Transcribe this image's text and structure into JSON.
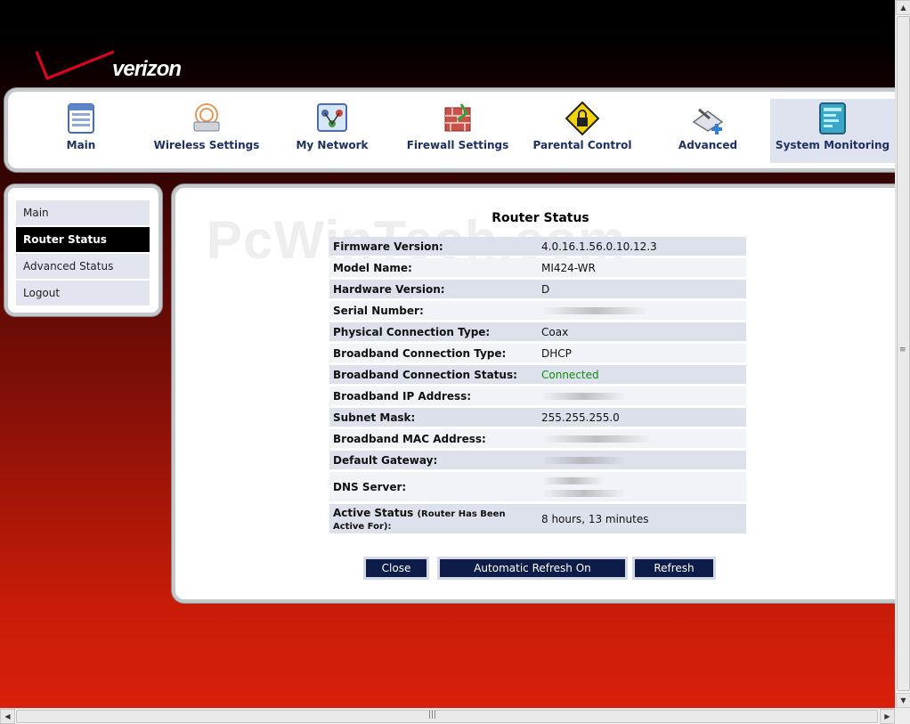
{
  "logo": {
    "text": "verizon"
  },
  "nav": {
    "items": [
      {
        "label": "Main",
        "icon": "main-table-icon"
      },
      {
        "label": "Wireless Settings",
        "icon": "wireless-router-icon"
      },
      {
        "label": "My Network",
        "icon": "network-icon"
      },
      {
        "label": "Firewall Settings",
        "icon": "firewall-icon"
      },
      {
        "label": "Parental Control",
        "icon": "lock-sign-icon"
      },
      {
        "label": "Advanced",
        "icon": "advanced-tools-icon"
      },
      {
        "label": "System Monitoring",
        "icon": "monitor-icon",
        "active": true
      }
    ]
  },
  "sidebar": {
    "items": [
      {
        "label": "Main"
      },
      {
        "label": "Router Status",
        "active": true
      },
      {
        "label": "Advanced Status"
      },
      {
        "label": "Logout"
      }
    ]
  },
  "watermark": "PcWinTech.com",
  "page_title": "Router Status",
  "status_rows": [
    {
      "label": "Firmware Version:",
      "value": "4.0.16.1.56.0.10.12.3"
    },
    {
      "label": "Model Name:",
      "value": "MI424-WR"
    },
    {
      "label": "Hardware Version:",
      "value": "D"
    },
    {
      "label": "Serial Number:",
      "value": ""
    },
    {
      "label": "Physical Connection Type:",
      "value": "Coax"
    },
    {
      "label": "Broadband Connection Type:",
      "value": "DHCP"
    },
    {
      "label": "Broadband Connection Status:",
      "value": "Connected"
    },
    {
      "label": "Broadband IP Address:",
      "value": ""
    },
    {
      "label": "Subnet Mask:",
      "value": "255.255.255.0"
    },
    {
      "label": "Broadband MAC Address:",
      "value": ""
    },
    {
      "label": "Default Gateway:",
      "value": ""
    },
    {
      "label": "DNS Server:",
      "value": ""
    },
    {
      "label": "Active Status",
      "label_note": "(Router Has Been Active For):",
      "value": "8 hours, 13 minutes"
    }
  ],
  "buttons": {
    "close": "Close",
    "auto_refresh": "Automatic Refresh On",
    "refresh": "Refresh"
  },
  "colors": {
    "nav_text": "#1d3162",
    "connected": "#118a11",
    "button_bg": "#0e1c4a"
  }
}
